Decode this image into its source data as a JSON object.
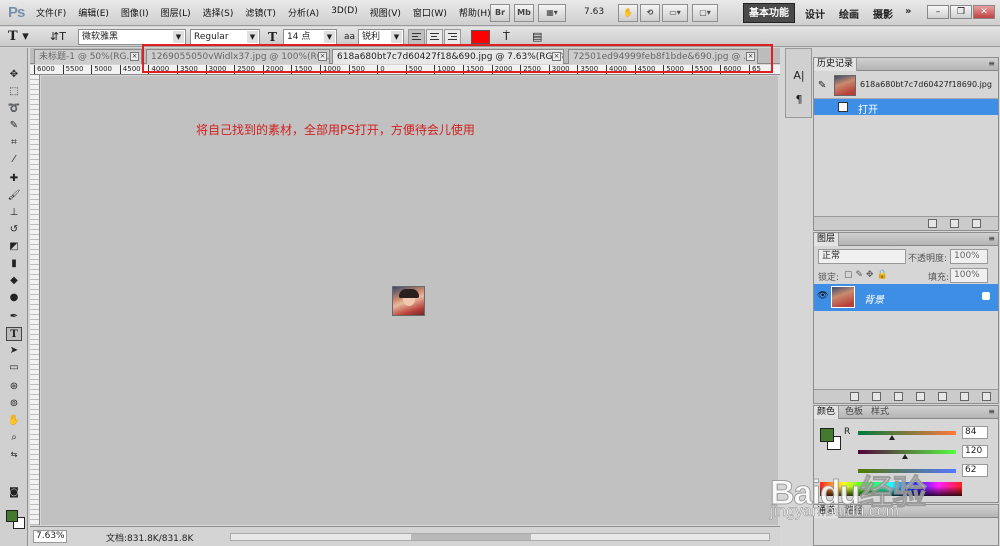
{
  "menubar": {
    "logo": "Ps",
    "items": [
      "文件(F)",
      "编辑(E)",
      "图像(I)",
      "图层(L)",
      "选择(S)",
      "滤镜(T)",
      "分析(A)",
      "3D(D)",
      "视图(V)",
      "窗口(W)",
      "帮助(H)"
    ],
    "bridge_label": "Br",
    "minibridge_label": "Mb",
    "zoom": "7.63",
    "workspaces": {
      "active": "基本功能",
      "design": "设计",
      "paint": "绘画",
      "photo": "摄影",
      "more": "»"
    }
  },
  "options": {
    "tool_icon": "text-tool-icon",
    "font_family": "微软雅黑",
    "font_style": "Regular",
    "font_size": "14 点",
    "antialias": "锐利",
    "antialias_prefix": "aa",
    "text_color": "#ff0000"
  },
  "tabs": [
    {
      "label": "未标题-1 @ 50%(RG...",
      "active": false
    },
    {
      "label": "1269055050vWidlx37.jpg @ 100%(RG...",
      "active": false
    },
    {
      "label": "618a680bt7c7d60427f18&690.jpg @ 7.63%(RGB/8#)",
      "active": true
    },
    {
      "label": "72501ed94999feb8f1bde&690.jpg @ ...",
      "active": false
    }
  ],
  "ruler_h": [
    "6000",
    "5500",
    "5000",
    "4500",
    "4000",
    "3500",
    "3000",
    "2500",
    "2000",
    "1500",
    "1000",
    "500",
    "0",
    "500",
    "1000",
    "1500",
    "2000",
    "2500",
    "3000",
    "3500",
    "4000",
    "4500",
    "5000",
    "5500",
    "6000",
    "65"
  ],
  "annotation": "将自己找到的素材，全部用PS打开，方便待会儿使用",
  "status": {
    "zoom": "7.63%",
    "doc_size": "文档:831.8K/831.8K"
  },
  "history": {
    "tab": "历史记录",
    "snapshot_name": "618a680bt7c7d60427f18690.jpg",
    "state": "打开"
  },
  "layers": {
    "tabs": [
      "图层"
    ],
    "blend_mode": "正常",
    "opacity_label": "不透明度:",
    "opacity": "100%",
    "lock_label": "锁定:",
    "fill_label": "填充:",
    "fill": "100%",
    "layer_name": "背景"
  },
  "color": {
    "tabs": [
      "颜色",
      "色板",
      "样式"
    ],
    "fg": "#447a2e",
    "bg": "#ffffff",
    "r_label": "R",
    "r": "84",
    "g": "120",
    "b": "62"
  },
  "paths": {
    "tabs": [
      "通道",
      "路径"
    ]
  },
  "watermark": {
    "text": "Baidu经验",
    "url": "jingyan.baidu.com"
  }
}
